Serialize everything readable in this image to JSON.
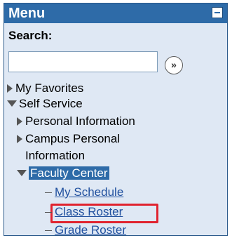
{
  "menu": {
    "title": "Menu"
  },
  "search": {
    "label": "Search:",
    "value": "",
    "placeholder": ""
  },
  "tree": {
    "my_favorites": "My Favorites",
    "self_service": "Self Service",
    "personal_information": "Personal Information",
    "campus_personal_line1": "Campus Personal",
    "campus_personal_line2": "Information",
    "faculty_center": "Faculty Center",
    "my_schedule": "My Schedule",
    "class_roster": "Class Roster",
    "grade_roster": "Grade Roster"
  },
  "colors": {
    "header": "#2e6ba8",
    "panel": "#dfe8f4",
    "link": "#1f4f9e",
    "highlight_box": "#e0232f"
  },
  "icons": {
    "collapse": "minus-box-icon",
    "go": "double-chevron-right-icon",
    "expand": "triangle-right-icon",
    "expanded": "triangle-down-icon"
  }
}
